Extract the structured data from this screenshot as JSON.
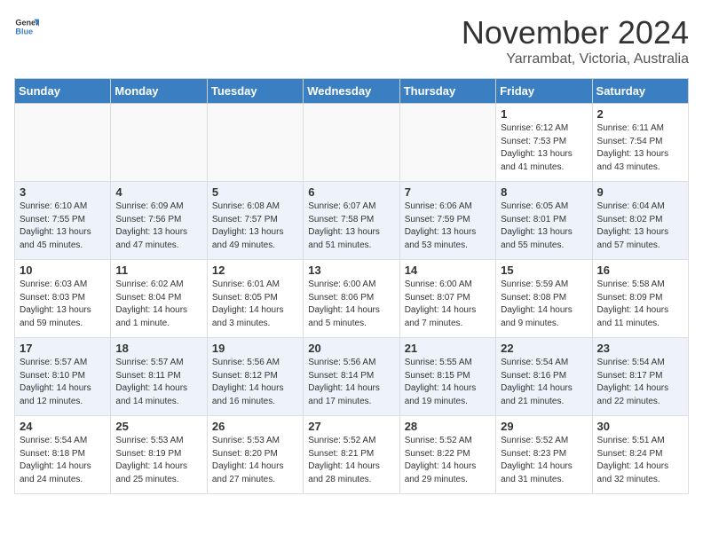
{
  "header": {
    "logo_line1": "General",
    "logo_line2": "Blue",
    "month": "November 2024",
    "location": "Yarrambat, Victoria, Australia"
  },
  "weekdays": [
    "Sunday",
    "Monday",
    "Tuesday",
    "Wednesday",
    "Thursday",
    "Friday",
    "Saturday"
  ],
  "weeks": [
    [
      {
        "day": "",
        "info": ""
      },
      {
        "day": "",
        "info": ""
      },
      {
        "day": "",
        "info": ""
      },
      {
        "day": "",
        "info": ""
      },
      {
        "day": "",
        "info": ""
      },
      {
        "day": "1",
        "info": "Sunrise: 6:12 AM\nSunset: 7:53 PM\nDaylight: 13 hours\nand 41 minutes."
      },
      {
        "day": "2",
        "info": "Sunrise: 6:11 AM\nSunset: 7:54 PM\nDaylight: 13 hours\nand 43 minutes."
      }
    ],
    [
      {
        "day": "3",
        "info": "Sunrise: 6:10 AM\nSunset: 7:55 PM\nDaylight: 13 hours\nand 45 minutes."
      },
      {
        "day": "4",
        "info": "Sunrise: 6:09 AM\nSunset: 7:56 PM\nDaylight: 13 hours\nand 47 minutes."
      },
      {
        "day": "5",
        "info": "Sunrise: 6:08 AM\nSunset: 7:57 PM\nDaylight: 13 hours\nand 49 minutes."
      },
      {
        "day": "6",
        "info": "Sunrise: 6:07 AM\nSunset: 7:58 PM\nDaylight: 13 hours\nand 51 minutes."
      },
      {
        "day": "7",
        "info": "Sunrise: 6:06 AM\nSunset: 7:59 PM\nDaylight: 13 hours\nand 53 minutes."
      },
      {
        "day": "8",
        "info": "Sunrise: 6:05 AM\nSunset: 8:01 PM\nDaylight: 13 hours\nand 55 minutes."
      },
      {
        "day": "9",
        "info": "Sunrise: 6:04 AM\nSunset: 8:02 PM\nDaylight: 13 hours\nand 57 minutes."
      }
    ],
    [
      {
        "day": "10",
        "info": "Sunrise: 6:03 AM\nSunset: 8:03 PM\nDaylight: 13 hours\nand 59 minutes."
      },
      {
        "day": "11",
        "info": "Sunrise: 6:02 AM\nSunset: 8:04 PM\nDaylight: 14 hours\nand 1 minute."
      },
      {
        "day": "12",
        "info": "Sunrise: 6:01 AM\nSunset: 8:05 PM\nDaylight: 14 hours\nand 3 minutes."
      },
      {
        "day": "13",
        "info": "Sunrise: 6:00 AM\nSunset: 8:06 PM\nDaylight: 14 hours\nand 5 minutes."
      },
      {
        "day": "14",
        "info": "Sunrise: 6:00 AM\nSunset: 8:07 PM\nDaylight: 14 hours\nand 7 minutes."
      },
      {
        "day": "15",
        "info": "Sunrise: 5:59 AM\nSunset: 8:08 PM\nDaylight: 14 hours\nand 9 minutes."
      },
      {
        "day": "16",
        "info": "Sunrise: 5:58 AM\nSunset: 8:09 PM\nDaylight: 14 hours\nand 11 minutes."
      }
    ],
    [
      {
        "day": "17",
        "info": "Sunrise: 5:57 AM\nSunset: 8:10 PM\nDaylight: 14 hours\nand 12 minutes."
      },
      {
        "day": "18",
        "info": "Sunrise: 5:57 AM\nSunset: 8:11 PM\nDaylight: 14 hours\nand 14 minutes."
      },
      {
        "day": "19",
        "info": "Sunrise: 5:56 AM\nSunset: 8:12 PM\nDaylight: 14 hours\nand 16 minutes."
      },
      {
        "day": "20",
        "info": "Sunrise: 5:56 AM\nSunset: 8:14 PM\nDaylight: 14 hours\nand 17 minutes."
      },
      {
        "day": "21",
        "info": "Sunrise: 5:55 AM\nSunset: 8:15 PM\nDaylight: 14 hours\nand 19 minutes."
      },
      {
        "day": "22",
        "info": "Sunrise: 5:54 AM\nSunset: 8:16 PM\nDaylight: 14 hours\nand 21 minutes."
      },
      {
        "day": "23",
        "info": "Sunrise: 5:54 AM\nSunset: 8:17 PM\nDaylight: 14 hours\nand 22 minutes."
      }
    ],
    [
      {
        "day": "24",
        "info": "Sunrise: 5:54 AM\nSunset: 8:18 PM\nDaylight: 14 hours\nand 24 minutes."
      },
      {
        "day": "25",
        "info": "Sunrise: 5:53 AM\nSunset: 8:19 PM\nDaylight: 14 hours\nand 25 minutes."
      },
      {
        "day": "26",
        "info": "Sunrise: 5:53 AM\nSunset: 8:20 PM\nDaylight: 14 hours\nand 27 minutes."
      },
      {
        "day": "27",
        "info": "Sunrise: 5:52 AM\nSunset: 8:21 PM\nDaylight: 14 hours\nand 28 minutes."
      },
      {
        "day": "28",
        "info": "Sunrise: 5:52 AM\nSunset: 8:22 PM\nDaylight: 14 hours\nand 29 minutes."
      },
      {
        "day": "29",
        "info": "Sunrise: 5:52 AM\nSunset: 8:23 PM\nDaylight: 14 hours\nand 31 minutes."
      },
      {
        "day": "30",
        "info": "Sunrise: 5:51 AM\nSunset: 8:24 PM\nDaylight: 14 hours\nand 32 minutes."
      }
    ]
  ]
}
